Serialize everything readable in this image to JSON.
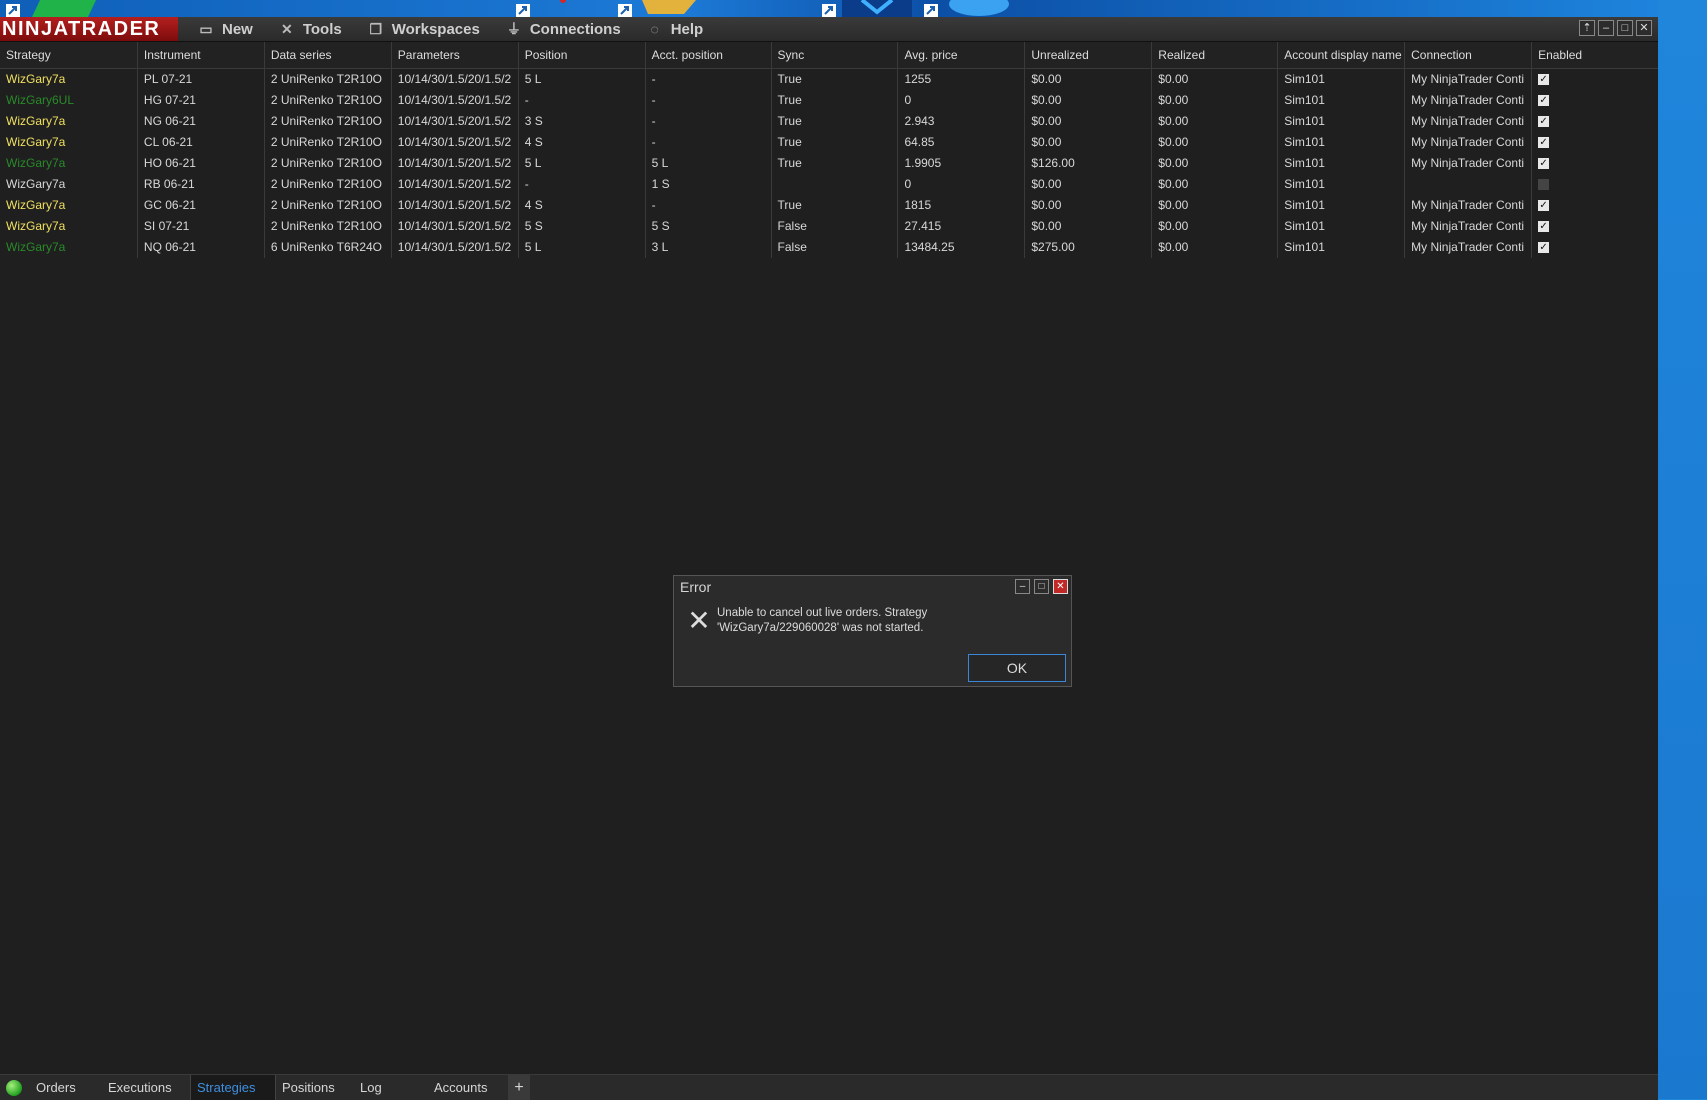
{
  "app": {
    "logo": "NINJATRADER",
    "menu": [
      {
        "label": "New",
        "icon": "new-window-icon"
      },
      {
        "label": "Tools",
        "icon": "tools-icon"
      },
      {
        "label": "Workspaces",
        "icon": "workspaces-icon"
      },
      {
        "label": "Connections",
        "icon": "plug-icon"
      },
      {
        "label": "Help",
        "icon": "help-icon"
      }
    ]
  },
  "grid": {
    "columns": [
      "Strategy",
      "Instrument",
      "Data series",
      "Parameters",
      "Position",
      "Acct. position",
      "Sync",
      "Avg. price",
      "Unrealized",
      "Realized",
      "Account display name",
      "Connection",
      "Enabled"
    ],
    "rows": [
      {
        "strategy": "WizGary7a",
        "strategy_color": "#f0e060",
        "instrument": "PL 07-21",
        "data_series": "2 UniRenko T2R10O",
        "parameters": "10/14/30/1.5/20/1.5/2",
        "position": "5 L",
        "acct_position": "-",
        "sync": "True",
        "avg_price": "1255",
        "unrealized": "$0.00",
        "realized": "$0.00",
        "account": "Sim101",
        "connection": "My NinjaTrader Conti",
        "enabled": true
      },
      {
        "strategy": "WizGary6UL",
        "strategy_color": "#2a8a2a",
        "instrument": "HG 07-21",
        "data_series": "2 UniRenko T2R10O",
        "parameters": "10/14/30/1.5/20/1.5/2",
        "position": "-",
        "acct_position": "-",
        "sync": "True",
        "avg_price": "0",
        "unrealized": "$0.00",
        "realized": "$0.00",
        "account": "Sim101",
        "connection": "My NinjaTrader Conti",
        "enabled": true
      },
      {
        "strategy": "WizGary7a",
        "strategy_color": "#f0e060",
        "instrument": "NG 06-21",
        "data_series": "2 UniRenko T2R10O",
        "parameters": "10/14/30/1.5/20/1.5/2",
        "position": "3 S",
        "acct_position": "-",
        "sync": "True",
        "avg_price": "2.943",
        "unrealized": "$0.00",
        "realized": "$0.00",
        "account": "Sim101",
        "connection": "My NinjaTrader Conti",
        "enabled": true
      },
      {
        "strategy": "WizGary7a",
        "strategy_color": "#f0e060",
        "instrument": "CL 06-21",
        "data_series": "2 UniRenko T2R10O",
        "parameters": "10/14/30/1.5/20/1.5/2",
        "position": "4 S",
        "acct_position": "-",
        "sync": "True",
        "avg_price": "64.85",
        "unrealized": "$0.00",
        "realized": "$0.00",
        "account": "Sim101",
        "connection": "My NinjaTrader Conti",
        "enabled": true
      },
      {
        "strategy": "WizGary7a",
        "strategy_color": "#2a8a2a",
        "instrument": "HO 06-21",
        "data_series": "2 UniRenko T2R10O",
        "parameters": "10/14/30/1.5/20/1.5/2",
        "position": "5 L",
        "acct_position": "5 L",
        "sync": "True",
        "avg_price": "1.9905",
        "unrealized": "$126.00",
        "realized": "$0.00",
        "account": "Sim101",
        "connection": "My NinjaTrader Conti",
        "enabled": true
      },
      {
        "strategy": "WizGary7a",
        "strategy_color": "#d8d8d8",
        "instrument": "RB 06-21",
        "data_series": "2 UniRenko T2R10O",
        "parameters": "10/14/30/1.5/20/1.5/2",
        "position": "-",
        "acct_position": "1 S",
        "sync": "",
        "avg_price": "0",
        "unrealized": "$0.00",
        "realized": "$0.00",
        "account": "Sim101",
        "connection": "",
        "enabled": false
      },
      {
        "strategy": "WizGary7a",
        "strategy_color": "#f0e060",
        "instrument": "GC 06-21",
        "data_series": "2 UniRenko T2R10O",
        "parameters": "10/14/30/1.5/20/1.5/2",
        "position": "4 S",
        "acct_position": "-",
        "sync": "True",
        "avg_price": "1815",
        "unrealized": "$0.00",
        "realized": "$0.00",
        "account": "Sim101",
        "connection": "My NinjaTrader Conti",
        "enabled": true
      },
      {
        "strategy": "WizGary7a",
        "strategy_color": "#f0e060",
        "instrument": "SI 07-21",
        "data_series": "2 UniRenko T2R10O",
        "parameters": "10/14/30/1.5/20/1.5/2",
        "position": "5 S",
        "acct_position": "5 S",
        "sync": "False",
        "avg_price": "27.415",
        "unrealized": "$0.00",
        "realized": "$0.00",
        "account": "Sim101",
        "connection": "My NinjaTrader Conti",
        "enabled": true
      },
      {
        "strategy": "WizGary7a",
        "strategy_color": "#2a8a2a",
        "instrument": "NQ 06-21",
        "data_series": "6 UniRenko T6R24O",
        "parameters": "10/14/30/1.5/20/1.5/2",
        "position": "5 L",
        "acct_position": "3 L",
        "sync": "False",
        "avg_price": "13484.25",
        "unrealized": "$275.00",
        "realized": "$0.00",
        "account": "Sim101",
        "connection": "My NinjaTrader Conti",
        "enabled": true
      }
    ]
  },
  "tabs": [
    {
      "label": "Orders",
      "active": false
    },
    {
      "label": "Executions",
      "active": false
    },
    {
      "label": "Strategies",
      "active": true
    },
    {
      "label": "Positions",
      "active": false
    },
    {
      "label": "Log",
      "active": false
    },
    {
      "label": "Accounts",
      "active": false
    }
  ],
  "add_tab_label": "+",
  "dialog": {
    "title": "Error",
    "message_line1": "Unable to cancel out live orders. Strategy",
    "message_line2": "'WizGary7a/229060028' was not started.",
    "ok_label": "OK"
  },
  "colors": {
    "accent": "#3e8fe0",
    "logo_red": "#b51f1f",
    "status_green": "#21a021"
  }
}
